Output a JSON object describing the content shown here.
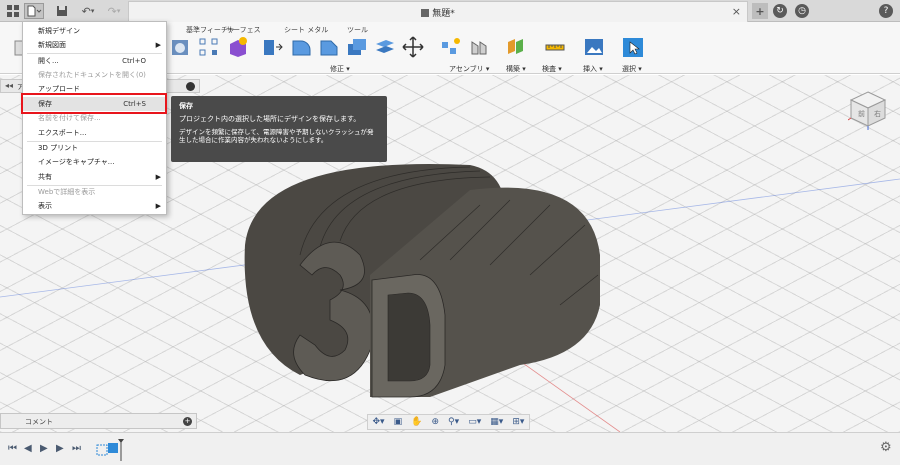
{
  "titlebar": {
    "document_title": "無題*",
    "close_glyph": "×",
    "add_tab_glyph": "+",
    "help_glyph": "?"
  },
  "ribbon": {
    "tabs": [
      "基準フィーチャ",
      "サーフェス",
      "シート メタル",
      "ツール"
    ],
    "groups": [
      "修正 ▾",
      "アセンブリ ▾",
      "構築 ▾",
      "検査 ▾",
      "挿入 ▾",
      "選択 ▾"
    ]
  },
  "file_menu": {
    "items": [
      {
        "label": "新規デザイン",
        "shortcut": "",
        "submenu": false,
        "disabled": false
      },
      {
        "label": "新規図面",
        "shortcut": "",
        "submenu": true,
        "disabled": false
      },
      {
        "label": "開く...",
        "shortcut": "Ctrl+O",
        "submenu": false,
        "disabled": false
      },
      {
        "label": "保存されたドキュメントを開く(0)",
        "shortcut": "",
        "submenu": false,
        "disabled": true
      },
      {
        "label": "アップロード",
        "shortcut": "",
        "submenu": false,
        "disabled": false
      },
      {
        "label": "保存",
        "shortcut": "Ctrl+S",
        "submenu": false,
        "disabled": false
      },
      {
        "label": "名前を付けて保存...",
        "shortcut": "",
        "submenu": false,
        "disabled": true
      },
      {
        "label": "エクスポート...",
        "shortcut": "",
        "submenu": false,
        "disabled": false
      },
      {
        "label": "3D プリント",
        "shortcut": "",
        "submenu": false,
        "disabled": false
      },
      {
        "label": "イメージをキャプチャ...",
        "shortcut": "",
        "submenu": false,
        "disabled": false
      },
      {
        "label": "共有",
        "shortcut": "",
        "submenu": true,
        "disabled": false
      },
      {
        "label": "Webで詳細を表示",
        "shortcut": "",
        "submenu": false,
        "disabled": true
      },
      {
        "label": "表示",
        "shortcut": "",
        "submenu": true,
        "disabled": false
      }
    ]
  },
  "tooltip": {
    "title": "保存",
    "line1": "プロジェクト内の選択した場所にデザインを保存します。",
    "desc": "デザインを頻繁に保存して、電源障害や予期しないクラッシュが発生した場合に作業内容が失われないようにします。"
  },
  "viewcube": {
    "front": "前",
    "right": "右"
  },
  "comment_bar": {
    "label": "コメント"
  },
  "browser_strip": {
    "label": "ア"
  },
  "colors": {
    "highlight": "#e8151c",
    "tooltip_bg": "#4a4a4a",
    "model": "#4b4843"
  }
}
